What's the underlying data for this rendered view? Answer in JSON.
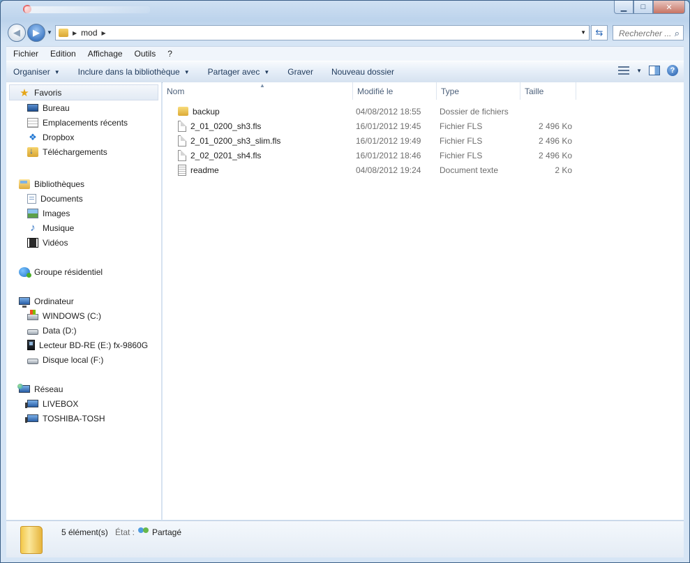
{
  "window": {
    "title_blurred": "",
    "min": "▁",
    "max": "□",
    "close": "✕"
  },
  "address": {
    "crumbs": [
      "mod"
    ]
  },
  "search": {
    "placeholder": "Rechercher ..."
  },
  "menu": [
    "Fichier",
    "Edition",
    "Affichage",
    "Outils",
    "?"
  ],
  "commands": [
    {
      "label": "Organiser",
      "dropdown": true
    },
    {
      "label": "Inclure dans la bibliothèque",
      "dropdown": true
    },
    {
      "label": "Partager avec",
      "dropdown": true
    },
    {
      "label": "Graver",
      "dropdown": false
    },
    {
      "label": "Nouveau dossier",
      "dropdown": false
    }
  ],
  "nav": {
    "favorites": {
      "label": "Favoris",
      "items": [
        {
          "label": "Bureau",
          "icon": "desktop-icon"
        },
        {
          "label": "Emplacements récents",
          "icon": "recent-places-icon"
        },
        {
          "label": "Dropbox",
          "icon": "dropbox-icon"
        },
        {
          "label": "Téléchargements",
          "icon": "downloads-icon"
        }
      ]
    },
    "libraries": {
      "label": "Bibliothèques",
      "items": [
        {
          "label": "Documents",
          "icon": "documents-icon"
        },
        {
          "label": "Images",
          "icon": "images-icon"
        },
        {
          "label": "Musique",
          "icon": "music-icon"
        },
        {
          "label": "Vidéos",
          "icon": "videos-icon"
        }
      ]
    },
    "homegroup": {
      "label": "Groupe résidentiel"
    },
    "computer": {
      "label": "Ordinateur",
      "items": [
        {
          "label": "WINDOWS (C:)",
          "icon": "windows-drive-icon"
        },
        {
          "label": "Data (D:)",
          "icon": "drive-icon"
        },
        {
          "label": "Lecteur BD-RE (E:) fx-9860G",
          "icon": "bd-drive-icon"
        },
        {
          "label": "Disque local (F:)",
          "icon": "drive-icon"
        }
      ]
    },
    "network": {
      "label": "Réseau",
      "items": [
        {
          "label": "LIVEBOX",
          "icon": "network-computer-icon"
        },
        {
          "label": "TOSHIBA-TOSH",
          "icon": "network-computer-icon"
        }
      ]
    }
  },
  "columns": {
    "name": "Nom",
    "modified": "Modifié le",
    "type": "Type",
    "size": "Taille"
  },
  "files": [
    {
      "name": "backup",
      "modified": "04/08/2012 18:55",
      "type": "Dossier de fichiers",
      "size": "",
      "icon": "folder-icon"
    },
    {
      "name": "2_01_0200_sh3.fls",
      "modified": "16/01/2012 19:45",
      "type": "Fichier FLS",
      "size": "2 496 Ko",
      "icon": "file-icon"
    },
    {
      "name": "2_01_0200_sh3_slim.fls",
      "modified": "16/01/2012 19:49",
      "type": "Fichier FLS",
      "size": "2 496 Ko",
      "icon": "file-icon"
    },
    {
      "name": "2_02_0201_sh4.fls",
      "modified": "16/01/2012 18:46",
      "type": "Fichier FLS",
      "size": "2 496 Ko",
      "icon": "file-icon"
    },
    {
      "name": "readme",
      "modified": "04/08/2012 19:24",
      "type": "Document texte",
      "size": "2 Ko",
      "icon": "text-file-icon"
    }
  ],
  "details": {
    "count": "5 élément(s)",
    "state_label": "État :",
    "state": "Partagé"
  }
}
